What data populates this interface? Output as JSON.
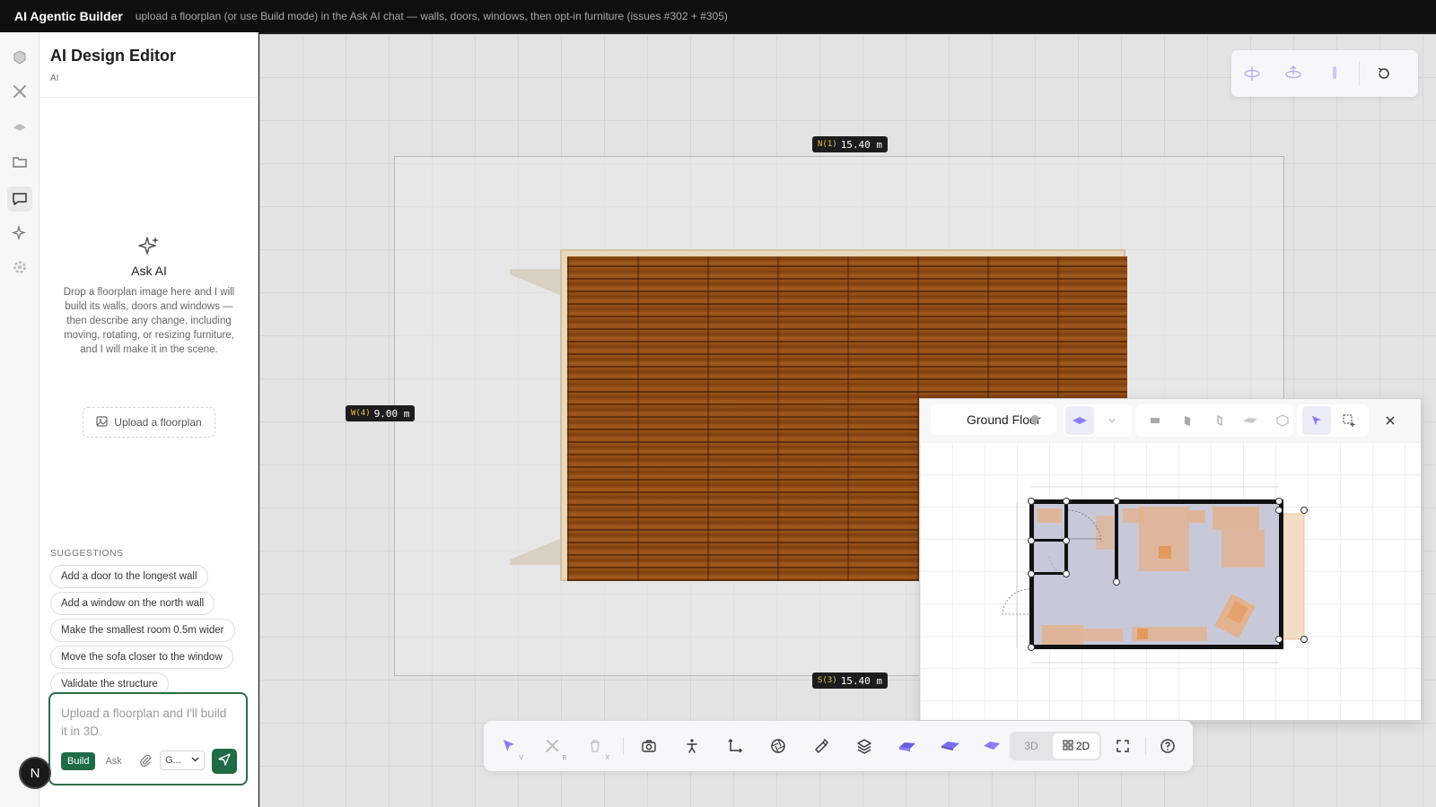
{
  "topbar": {
    "brand": "AI Agentic Builder",
    "subtitle": "upload a floorplan (or use Build mode) in the Ask AI chat — walls, doors, windows, then opt-in furniture (issues #302 + #305)"
  },
  "rail": {
    "items": [
      "cube-icon",
      "tools-icon",
      "layers-icon",
      "folder-icon",
      "chat-icon",
      "sparkles-icon",
      "gear-icon"
    ],
    "active": "chat-icon",
    "avatar_initial": "N"
  },
  "panel": {
    "title": "AI Design Editor",
    "subtitle": "AI",
    "ask_title": "Ask AI",
    "ask_description": "Drop a floorplan image here and I will build its walls, doors and windows — then describe any change, including moving, rotating, or resizing furniture, and I will make it in the scene.",
    "upload_label": "Upload a floorplan",
    "suggestions_header": "SUGGESTIONS",
    "suggestions": [
      "Add a door to the longest wall",
      "Add a window on the north wall",
      "Make the smallest room 0.5m wider",
      "Move the sofa closer to the window",
      "Validate the structure"
    ],
    "composer": {
      "placeholder": "Upload a floorplan and I'll build it in 3D.",
      "mode_build": "Build",
      "mode_ask": "Ask",
      "model_selected": "G..."
    }
  },
  "canvas": {
    "dims": {
      "north": {
        "key": "N(1)",
        "value": "15.40 m"
      },
      "west": {
        "key": "W(4)",
        "value": "9.00 m"
      },
      "south": {
        "key": "S(3)",
        "value": "15.40 m"
      }
    },
    "colors": {
      "accent": "#8b7cf6",
      "build_green": "#1f6b45",
      "wood": "#8a4712"
    }
  },
  "mini": {
    "level_label": "Ground Floor"
  },
  "toolbar": {
    "hotkeys": {
      "select": "V",
      "cut": "B",
      "delete": "X"
    },
    "mode_3d": "3D",
    "mode_2d": "2D",
    "active_mode": "2D"
  }
}
